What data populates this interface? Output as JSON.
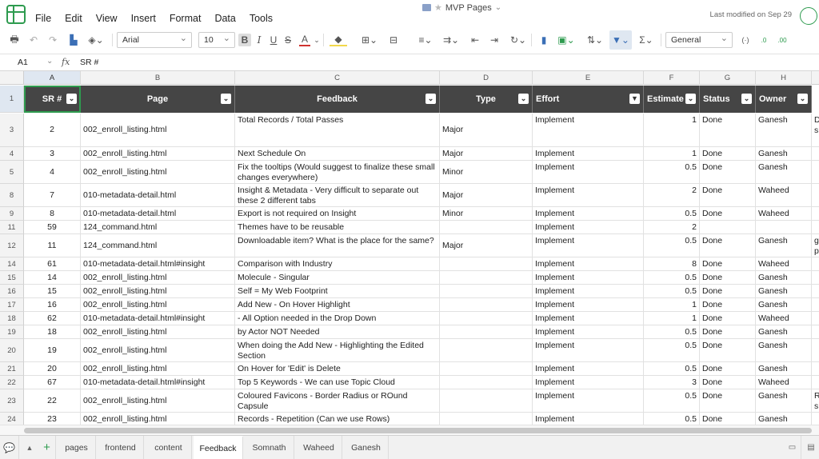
{
  "menu": [
    "File",
    "Edit",
    "View",
    "Insert",
    "Format",
    "Data",
    "Tools"
  ],
  "doc": {
    "title": "MVP Pages",
    "last_modified": "Last modified on Sep 29"
  },
  "toolbar": {
    "font": "Arial",
    "size": "10",
    "format": "General",
    "bold": "B",
    "italic": "I",
    "underline": "U",
    "strike": "S",
    "color_a": "A"
  },
  "formula": {
    "cell": "A1",
    "fx": "fx",
    "value": "SR #"
  },
  "colors": {
    "header_bg": "#454545",
    "accent": "#2e9b4f"
  },
  "columns": [
    "A",
    "B",
    "C",
    "D",
    "E",
    "F",
    "G",
    "H"
  ],
  "headers": [
    "SR #",
    "Page",
    "Feedback",
    "Type",
    "Effort",
    "Estimate",
    "Status",
    "Owner"
  ],
  "rows": [
    {
      "rn": "3",
      "sr": "2",
      "page": "002_enroll_listing.html",
      "fb": "Total Records / Total Passes",
      "type": "Major",
      "effort": "Implement",
      "est": "1",
      "status": "Done",
      "owner": "Ganesh",
      "extra": "D s"
    },
    {
      "rn": "4",
      "sr": "3",
      "page": "002_enroll_listing.html",
      "fb": "Next Schedule On",
      "type": "Major",
      "effort": "Implement",
      "est": "1",
      "status": "Done",
      "owner": "Ganesh",
      "extra": ""
    },
    {
      "rn": "5",
      "sr": "4",
      "page": "002_enroll_listing.html",
      "fb": "Fix the tooltips (Would suggest to finalize these small changes everywhere)",
      "type": "Minor",
      "effort": "Implement",
      "est": "0.5",
      "status": "Done",
      "owner": "Ganesh",
      "extra": ""
    },
    {
      "rn": "8",
      "sr": "7",
      "page": "010-metadata-detail.html",
      "fb": "Insight & Metadata - Very difficult to separate out these 2 different tabs",
      "type": "Major",
      "effort": "Implement",
      "est": "2",
      "status": "Done",
      "owner": "Waheed",
      "extra": ""
    },
    {
      "rn": "9",
      "sr": "8",
      "page": "010-metadata-detail.html",
      "fb": "Export is not required on Insight",
      "type": "Minor",
      "effort": "Implement",
      "est": "0.5",
      "status": "Done",
      "owner": "Waheed",
      "extra": ""
    },
    {
      "rn": "11",
      "sr": "59",
      "page": "124_command.html",
      "fb": "Themes have to be reusable",
      "type": "",
      "effort": "Implement",
      "est": "2",
      "status": "",
      "owner": "",
      "extra": ""
    },
    {
      "rn": "12",
      "sr": "11",
      "page": "124_command.html",
      "fb": "Downloadable item? What is the place for the same?",
      "type": "Major",
      "effort": "Implement",
      "est": "0.5",
      "status": "Done",
      "owner": "Ganesh",
      "extra": "g p"
    },
    {
      "rn": "14",
      "sr": "61",
      "page": "010-metadata-detail.html#insight",
      "fb": "Comparison with Industry",
      "type": "",
      "effort": "Implement",
      "est": "8",
      "status": "Done",
      "owner": "Waheed",
      "extra": ""
    },
    {
      "rn": "15",
      "sr": "14",
      "page": "002_enroll_listing.html",
      "fb": "Molecule - Singular",
      "type": "",
      "effort": "Implement",
      "est": "0.5",
      "status": "Done",
      "owner": "Ganesh",
      "extra": ""
    },
    {
      "rn": "16",
      "sr": "15",
      "page": "002_enroll_listing.html",
      "fb": "Self = My Web Footprint",
      "type": "",
      "effort": "Implement",
      "est": "0.5",
      "status": "Done",
      "owner": "Ganesh",
      "extra": ""
    },
    {
      "rn": "17",
      "sr": "16",
      "page": "002_enroll_listing.html",
      "fb": "Add New - On Hover Highlight",
      "type": "",
      "effort": "Implement",
      "est": "1",
      "status": "Done",
      "owner": "Ganesh",
      "extra": ""
    },
    {
      "rn": "18",
      "sr": "62",
      "page": "010-metadata-detail.html#insight",
      "fb": "- All Option needed in the Drop Down",
      "type": "",
      "effort": "Implement",
      "est": "1",
      "status": "Done",
      "owner": "Waheed",
      "extra": ""
    },
    {
      "rn": "19",
      "sr": "18",
      "page": "002_enroll_listing.html",
      "fb": "by Actor NOT Needed",
      "type": "",
      "effort": "Implement",
      "est": "0.5",
      "status": "Done",
      "owner": "Ganesh",
      "extra": ""
    },
    {
      "rn": "20",
      "sr": "19",
      "page": "002_enroll_listing.html",
      "fb": "When doing the Add New - Highlighting the Edited Section",
      "type": "",
      "effort": "Implement",
      "est": "0.5",
      "status": "Done",
      "owner": "Ganesh",
      "extra": ""
    },
    {
      "rn": "21",
      "sr": "20",
      "page": "002_enroll_listing.html",
      "fb": "On Hover for 'Edit' is Delete",
      "type": "",
      "effort": "Implement",
      "est": "0.5",
      "status": "Done",
      "owner": "Ganesh",
      "extra": ""
    },
    {
      "rn": "22",
      "sr": "67",
      "page": "010-metadata-detail.html#insight",
      "fb": "Top 5 Keywords - We can use Topic Cloud",
      "type": "",
      "effort": "Implement",
      "est": "3",
      "status": "Done",
      "owner": "Waheed",
      "extra": ""
    },
    {
      "rn": "23",
      "sr": "22",
      "page": "002_enroll_listing.html",
      "fb": "Coloured Favicons - Border Radius or ROund Capsule",
      "type": "",
      "effort": "Implement",
      "est": "0.5",
      "status": "Done",
      "owner": "Ganesh",
      "extra": "R s"
    },
    {
      "rn": "24",
      "sr": "23",
      "page": "002_enroll_listing.html",
      "fb": "Records - Repetition (Can we use Rows)",
      "type": "",
      "effort": "Implement",
      "est": "0.5",
      "status": "Done",
      "owner": "Ganesh",
      "extra": ""
    }
  ],
  "sheets": [
    "pages",
    "frontend",
    "content",
    "Feedback",
    "Somnath",
    "Waheed",
    "Ganesh"
  ],
  "active_sheet": "Feedback"
}
